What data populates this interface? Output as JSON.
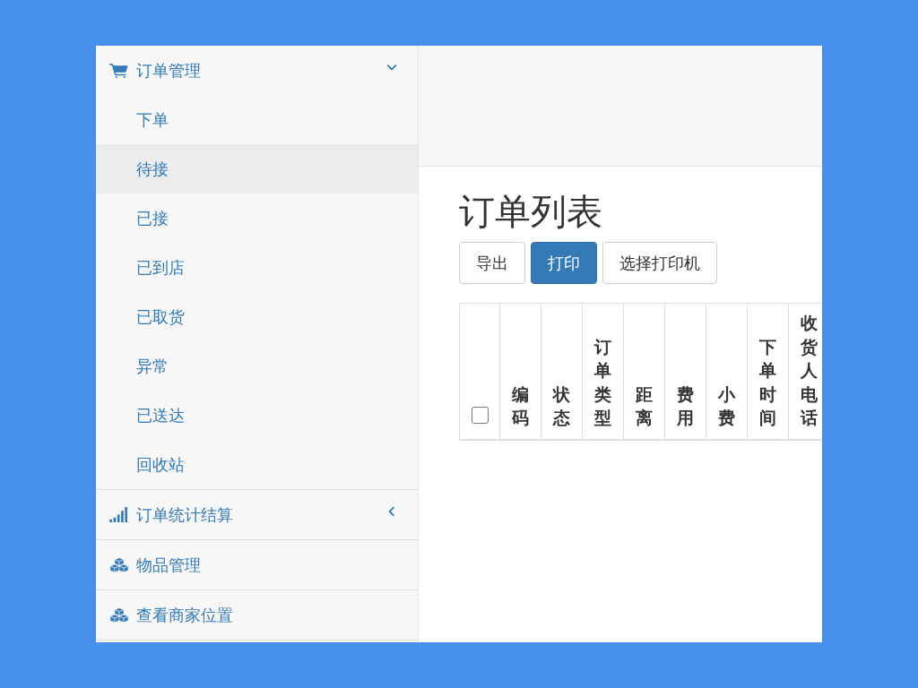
{
  "sidebar": {
    "groups": [
      {
        "label": "订单管理",
        "kind": "cart",
        "expanded": true,
        "items": [
          {
            "label": "下单",
            "selected": false
          },
          {
            "label": "待接",
            "selected": true
          },
          {
            "label": "已接",
            "selected": false
          },
          {
            "label": "已到店",
            "selected": false
          },
          {
            "label": "已取货",
            "selected": false
          },
          {
            "label": "异常",
            "selected": false
          },
          {
            "label": "已送达",
            "selected": false
          },
          {
            "label": "回收站",
            "selected": false
          }
        ]
      },
      {
        "label": "订单统计结算",
        "kind": "signal",
        "expanded": false
      },
      {
        "label": "物品管理",
        "kind": "cubes"
      },
      {
        "label": "查看商家位置",
        "kind": "cubes"
      }
    ]
  },
  "page": {
    "title": "订单列表",
    "buttons": [
      {
        "label": "导出",
        "primary": false
      },
      {
        "label": "打印",
        "primary": true
      },
      {
        "label": "选择打印机",
        "primary": false
      }
    ],
    "table": {
      "select_all": {
        "checked": false
      },
      "columns": [
        "编码",
        "状态",
        "订单类型",
        "距离",
        "费用",
        "小费",
        "下单时间",
        "收货人电话"
      ]
    }
  }
}
